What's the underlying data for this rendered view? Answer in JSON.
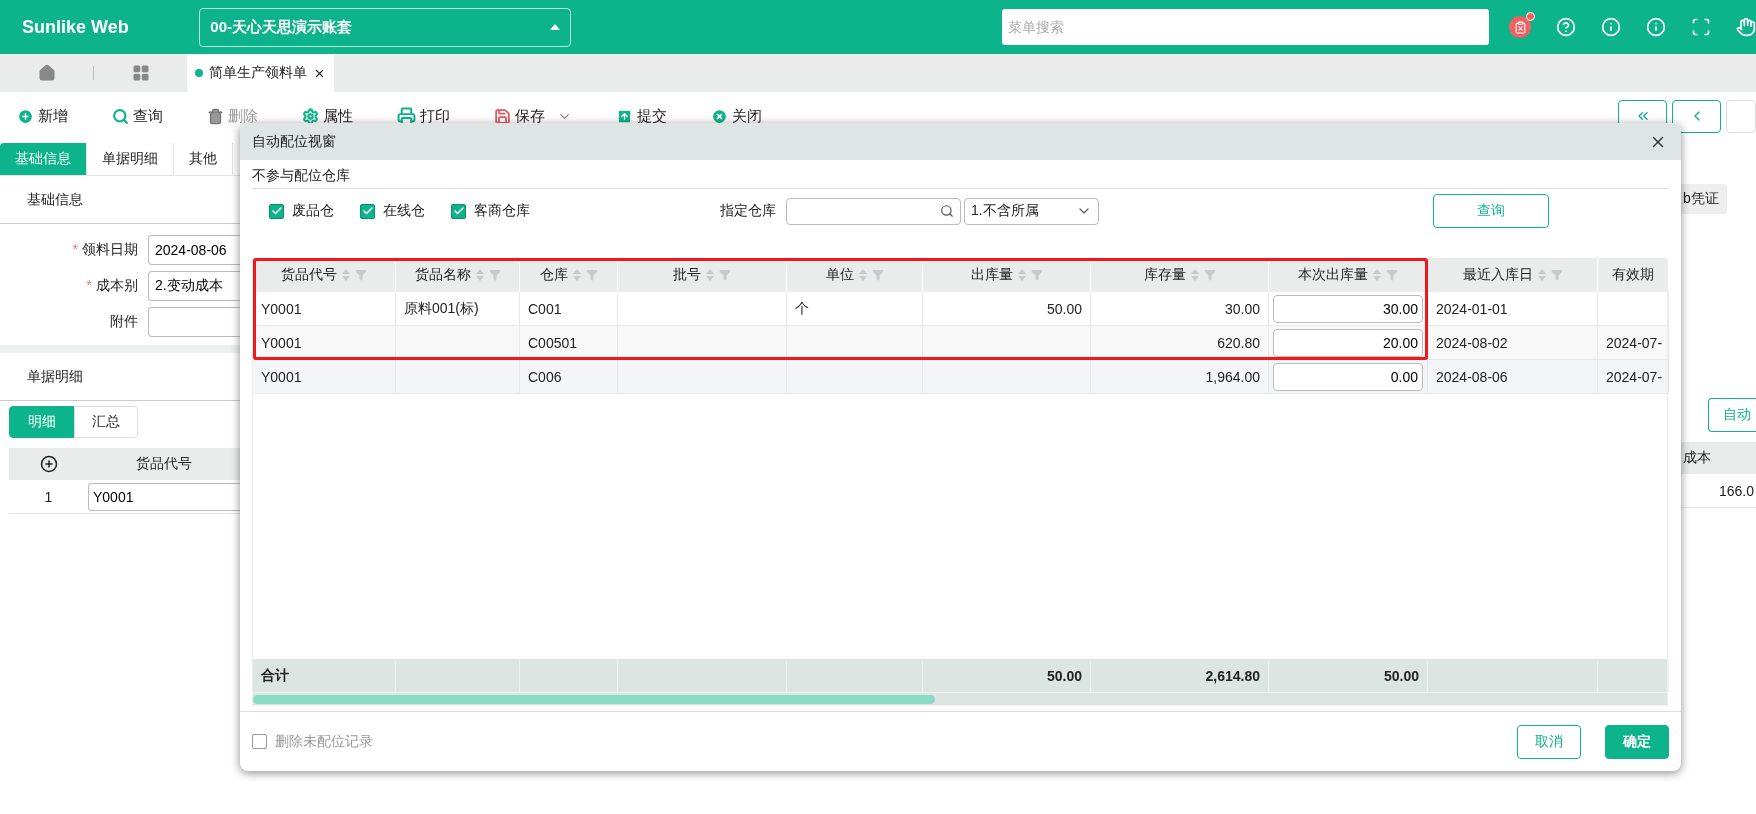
{
  "app": {
    "logo": "Sunlike Web",
    "account": "00-天心天思演示账套",
    "search": {
      "placeholder": "菜单搜索"
    },
    "header_icons": [
      {
        "kind": "notification",
        "badge": true
      },
      {
        "kind": "help",
        "badge": false
      },
      {
        "kind": "info",
        "badge": false
      },
      {
        "kind": "info",
        "badge": false
      },
      {
        "kind": "fullscreen",
        "badge": false
      },
      {
        "kind": "hand",
        "badge": false
      }
    ]
  },
  "page_tabs": [
    {
      "label": "简单生产领料单",
      "active": true
    }
  ],
  "toolbar": [
    {
      "kind": "add",
      "label": "新增",
      "disabled": false,
      "has_menu": false
    },
    {
      "kind": "query",
      "label": "查询",
      "disabled": false,
      "has_menu": false
    },
    {
      "kind": "delete",
      "label": "删除",
      "disabled": true,
      "has_menu": false
    },
    {
      "kind": "properties",
      "label": "属性",
      "disabled": false,
      "has_menu": false
    },
    {
      "kind": "print",
      "label": "打印",
      "disabled": false,
      "has_menu": false
    },
    {
      "kind": "save",
      "label": "保存",
      "disabled": false,
      "has_menu": true
    },
    {
      "kind": "submit",
      "label": "提交",
      "disabled": false,
      "has_menu": false
    },
    {
      "kind": "close",
      "label": "关闭",
      "disabled": false,
      "has_menu": false
    }
  ],
  "form_tabs": [
    {
      "label": "基础信息",
      "selected": true
    },
    {
      "label": "单据明细",
      "selected": false
    },
    {
      "label": "其他",
      "selected": false
    }
  ],
  "basic_section": {
    "title": "基础信息",
    "right_tag": "b凭证",
    "required_mark": "*",
    "fields": [
      {
        "label": "领料日期",
        "value": "2024-08-06",
        "required": true
      },
      {
        "label": "成本别",
        "value": "2.变动成本",
        "required": true
      },
      {
        "label": "附件",
        "required": false
      }
    ]
  },
  "detail_section": {
    "title": "单据明细",
    "views": [
      {
        "label": "明细",
        "selected": true
      },
      {
        "label": "汇总",
        "selected": false
      }
    ],
    "right_button": "自动",
    "grid": {
      "columns": [
        "货品代号"
      ],
      "right_column": "成本",
      "rows": [
        {
          "index": "1",
          "code": "Y0001",
          "right_value": "166.0"
        }
      ]
    }
  },
  "dialog": {
    "title": "自动配位视窗",
    "exclude_label": "不参与配位仓库",
    "exclude": [
      {
        "label": "废品仓",
        "checked": true
      },
      {
        "label": "在线仓",
        "checked": true
      },
      {
        "label": "客商仓库",
        "checked": true
      }
    ],
    "warehouse_label": "指定仓库",
    "scope": "1.不含所属",
    "query_button": "查询",
    "table": {
      "highlighted": true,
      "columns": [
        {
          "label": "货品代号",
          "kind": "text",
          "sortable": true,
          "total": "合计"
        },
        {
          "label": "货品名称",
          "kind": "text",
          "sortable": true
        },
        {
          "label": "仓库",
          "kind": "text",
          "sortable": true
        },
        {
          "label": "批号",
          "kind": "text",
          "sortable": true
        },
        {
          "label": "单位",
          "kind": "text",
          "sortable": true
        },
        {
          "label": "出库量",
          "kind": "number",
          "sortable": true,
          "total": "50.00"
        },
        {
          "label": "库存量",
          "kind": "number",
          "sortable": true,
          "total": "2,614.80"
        },
        {
          "label": "本次出库量",
          "kind": "input",
          "sortable": true,
          "total": "50.00"
        },
        {
          "label": "最近入库日",
          "kind": "text",
          "sortable": true
        },
        {
          "label": "有效期",
          "kind": "text",
          "sortable": false
        }
      ],
      "rows": [
        {
          "cells": [
            "Y0001",
            "原料001(标)",
            "C001",
            null,
            "个",
            "50.00",
            "30.00",
            "30.00",
            "2024-01-01",
            null
          ]
        },
        {
          "cells": [
            "Y0001",
            null,
            "C00501",
            null,
            null,
            null,
            "620.80",
            "20.00",
            "2024-08-02",
            "2024-07-"
          ]
        },
        {
          "cells": [
            "Y0001",
            null,
            "C006",
            null,
            null,
            null,
            "1,964.00",
            "0.00",
            "2024-08-06",
            "2024-07-"
          ]
        }
      ]
    },
    "remove_unassigned": {
      "label": "删除未配位记录",
      "checked": false,
      "disabled": true
    },
    "buttons": [
      {
        "kind": "secondary",
        "label": "取消"
      },
      {
        "kind": "primary",
        "label": "确定"
      }
    ]
  }
}
